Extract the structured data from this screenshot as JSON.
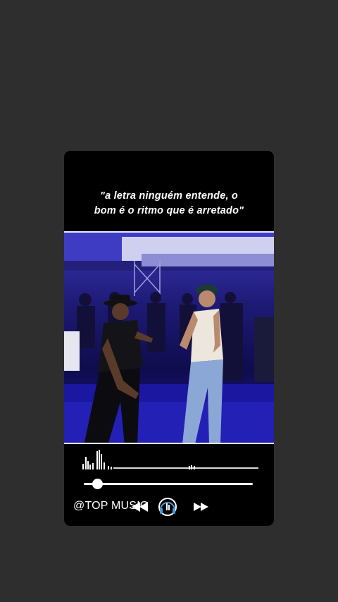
{
  "story": {
    "quote_line1": "\"a letra ninguém entende, o",
    "quote_line2": "bom é o ritmo que é arretado\""
  },
  "player": {
    "handle": "@TOP MUSIC",
    "progress_fraction": 0.08,
    "icons": {
      "previous": "rewind-icon",
      "headphones": "headphones-icon",
      "next": "fast-forward-icon"
    }
  },
  "colors": {
    "background": "#2e2e2e",
    "card": "#000000",
    "stage_blue": "#2a25a8",
    "text": "#ffffff"
  }
}
